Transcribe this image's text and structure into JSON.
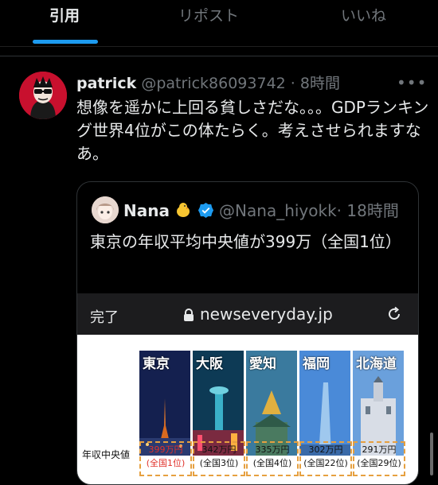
{
  "tabs": [
    {
      "label": "引用",
      "active": true
    },
    {
      "label": "リポスト",
      "active": false
    },
    {
      "label": "いいね",
      "active": false
    }
  ],
  "post": {
    "author_name": "patrick",
    "handle_time": "@patrick86093742 · 8時間",
    "text": "想像を遥かに上回る貧しさだな。。。GDPランキング世界4位がこの体たらく。考えさせられますなあ。"
  },
  "quote": {
    "author_name": "Nana",
    "handle_time": "@Nana_hiyokk· 18時間",
    "text": "東京の年収平均中央値が399万（全国1位）",
    "browser": {
      "done_label": "完了",
      "url": "newseveryday.jp"
    },
    "article": {
      "row_label": "年収中央値",
      "cities": [
        {
          "name": "東京",
          "value": "399万円",
          "rank": "(全国1位)",
          "color": "#1a2a6c"
        },
        {
          "name": "大阪",
          "value": "342万円",
          "rank": "(全国3位)",
          "color": "#0d4f6e"
        },
        {
          "name": "愛知",
          "value": "335万円",
          "rank": "(全国4位)",
          "color": "#2a6b8a"
        },
        {
          "name": "福岡",
          "value": "302万円",
          "rank": "(全国22位)",
          "color": "#3a80c8"
        },
        {
          "name": "北海道",
          "value": "291万円",
          "rank": "(全国29位)",
          "color": "#4a8cd0"
        }
      ]
    }
  },
  "colors": {
    "accent": "#1d9bf0",
    "value_highlight": "#e0312a",
    "box_border": "#e6a040"
  }
}
